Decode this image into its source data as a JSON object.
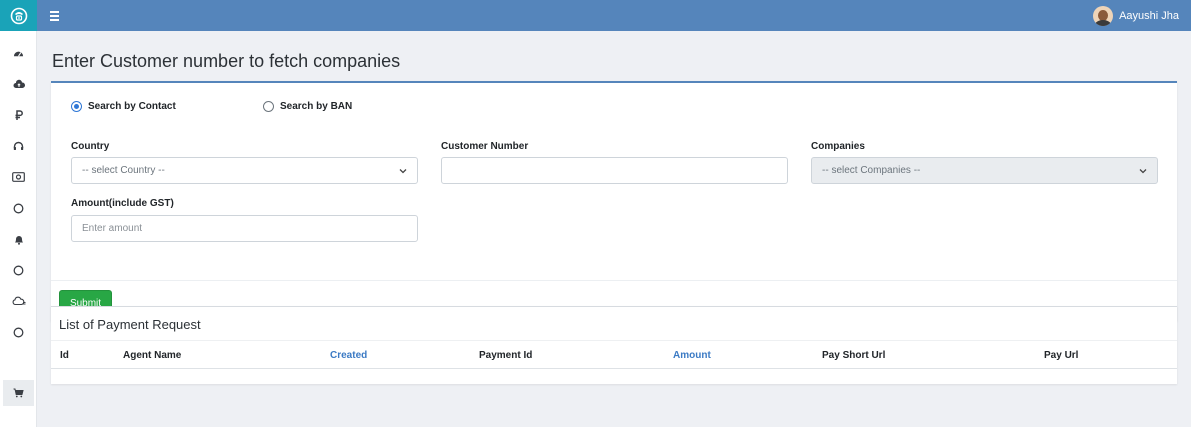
{
  "user": {
    "name": "Aayushi Jha"
  },
  "sidebar": {
    "items": [
      {
        "icon": "dashboard-icon"
      },
      {
        "icon": "cloud-upload-icon"
      },
      {
        "icon": "ruble-icon"
      },
      {
        "icon": "headset-icon"
      },
      {
        "icon": "money-icon"
      },
      {
        "icon": "circle-icon"
      },
      {
        "icon": "bell-icon"
      },
      {
        "icon": "circle-icon"
      },
      {
        "icon": "cloud-icon"
      },
      {
        "icon": "circle-icon"
      },
      {
        "icon": "cart-icon",
        "active": true
      }
    ]
  },
  "page": {
    "title": "Enter Customer number to fetch companies"
  },
  "search": {
    "options": [
      {
        "label": "Search by Contact",
        "checked": true
      },
      {
        "label": "Search by BAN",
        "checked": false
      }
    ]
  },
  "form": {
    "country": {
      "label": "Country",
      "selected": "-- select Country --"
    },
    "customer_number": {
      "label": "Customer Number",
      "value": ""
    },
    "companies": {
      "label": "Companies",
      "selected": "-- select Companies --",
      "disabled": true
    },
    "amount": {
      "label": "Amount(include GST)",
      "placeholder": "Enter amount"
    },
    "submit_label": "Submit"
  },
  "payments": {
    "title": "List of Payment Request",
    "columns": [
      {
        "label": "Id",
        "sortable": false
      },
      {
        "label": "Agent Name",
        "sortable": false
      },
      {
        "label": "Created",
        "sortable": true
      },
      {
        "label": "Payment Id",
        "sortable": false
      },
      {
        "label": "Amount",
        "sortable": true
      },
      {
        "label": "Pay Short Url",
        "sortable": false
      },
      {
        "label": "Pay Url",
        "sortable": false
      }
    ],
    "rows": []
  },
  "colors": {
    "topbar": "#5585bb",
    "logo_bg": "#1aa3b8",
    "submit": "#28a745",
    "link": "#3b7ac4"
  }
}
